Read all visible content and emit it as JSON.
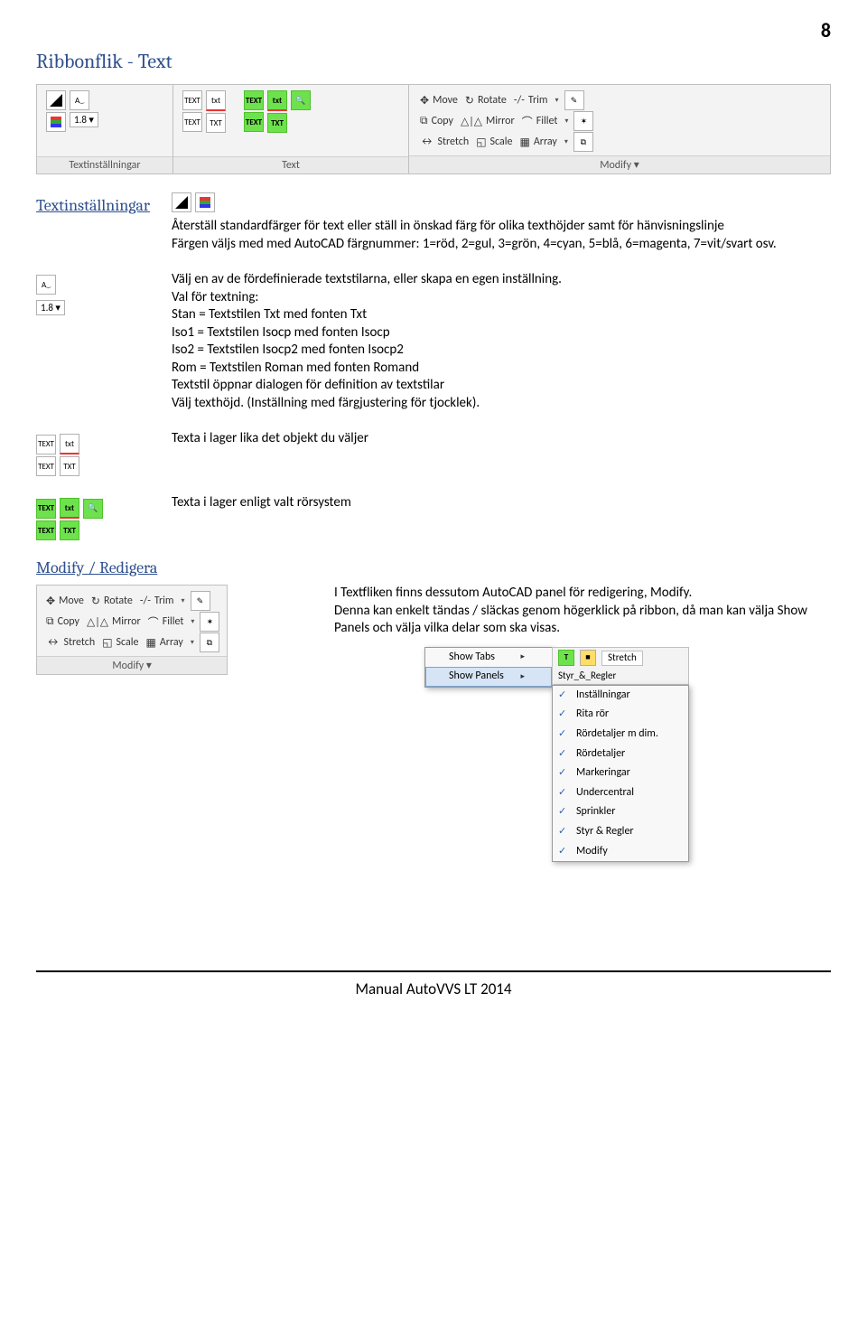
{
  "page_number": "8",
  "heading": "Ribbonflik - Text",
  "ribbon_top": {
    "panel1_title": "Textinställningar",
    "panel2_title": "Text",
    "panel3_title": "Modify ▾",
    "text_icon_label": "TEXT",
    "text_icon_label2": "TXT",
    "height_field": "1.8 ▾",
    "modify_items": {
      "move": "Move",
      "rotate": "Rotate",
      "trim": "Trim",
      "copy": "Copy",
      "mirror": "Mirror",
      "fillet": "Fillet",
      "stretch": "Stretch",
      "scale": "Scale",
      "array": "Array"
    }
  },
  "sections": {
    "s1_title": "Textinställningar",
    "s1_body": "Återställ standardfärger för text eller ställ in önskad färg för olika texthöjder samt för hänvisningslinje\nFärgen väljs med med AutoCAD färgnummer: 1=röd, 2=gul, 3=grön, 4=cyan, 5=blå, 6=magenta, 7=vit/svart osv.",
    "s2_body": "Välj en av de fördefinierade textstilarna, eller skapa en egen inställning.\nVal för textning:\nStan = Textstilen Txt med fonten Txt\nIso1 = Textstilen Isocp med fonten Isocp\nIso2 = Textstilen Isocp2 med fonten Isocp2\nRom = Textstilen Roman med fonten Romand\nTextstil öppnar dialogen för definition av textstilar\nVälj texthöjd. (Inställning med färgjustering för tjocklek).",
    "s2_height": "1.8 ▾",
    "s3_body": "Texta i lager lika det objekt du väljer",
    "s4_body": "Texta i lager enligt valt rörsystem"
  },
  "modify_section": {
    "title": "Modify / Redigera",
    "panel_title": "Modify ▾",
    "body": "I Textfliken finns dessutom AutoCAD panel för redigering, Modify.\nDenna kan enkelt tändas / släckas genom högerklick på ribbon, då man kan välja Show Panels och välja vilka delar som ska visas.",
    "items": {
      "move": "Move",
      "rotate": "Rotate",
      "trim": "Trim",
      "copy": "Copy",
      "mirror": "Mirror",
      "fillet": "Fillet",
      "stretch": "Stretch",
      "scale": "Scale",
      "array": "Array"
    }
  },
  "context_menu": {
    "show_tabs": "Show Tabs",
    "show_panels": "Show Panels",
    "sub": {
      "stretch": "Stretch",
      "styr_regler_top": "Styr_&_Regler",
      "installningar": "Inställningar",
      "rita_ror": "Rita rör",
      "rordetaljer_m_dim": "Rördetaljer m dim.",
      "rordetaljer": "Rördetaljer",
      "markeringar": "Markeringar",
      "undercentral": "Undercentral",
      "sprinkler": "Sprinkler",
      "styr_regler": "Styr & Regler",
      "modify": "Modify"
    }
  },
  "footer": "Manual AutoVVS LT 2014"
}
